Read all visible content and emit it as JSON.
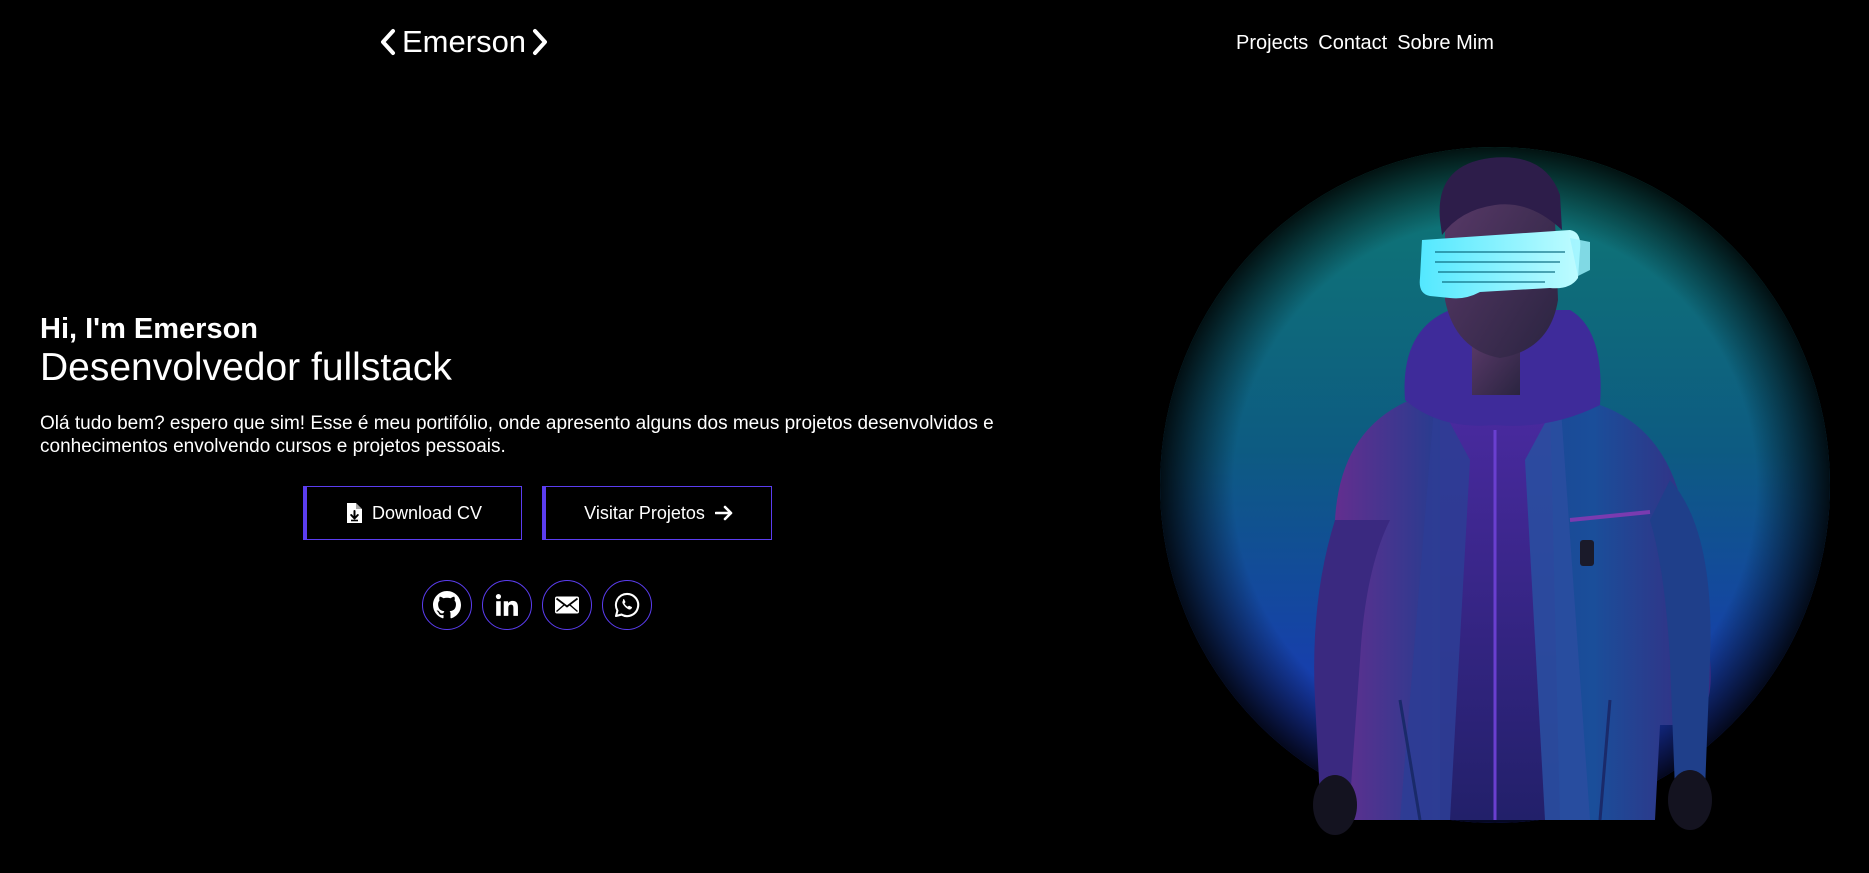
{
  "header": {
    "logo_text": "Emerson",
    "nav": [
      "Projects",
      "Contact",
      "Sobre Mim"
    ]
  },
  "hero": {
    "greeting": "Hi, I'm Emerson",
    "role": "Desenvolvedor fullstack",
    "intro": "Olá tudo bem? espero que sim! Esse é meu portifólio, onde apresento alguns dos meus projetos desenvolvidos e conhecimentos envolvendo cursos e projetos pessoais.",
    "download_label": "Download CV",
    "projects_label": "Visitar Projetos"
  },
  "socials": [
    {
      "name": "github-icon"
    },
    {
      "name": "linkedin-icon"
    },
    {
      "name": "email-icon"
    },
    {
      "name": "whatsapp-icon"
    }
  ],
  "colors": {
    "background": "#000000",
    "accent": "#5b3df0",
    "glow_top": "#0f7a73",
    "glow_bottom": "#1d2cc9"
  }
}
